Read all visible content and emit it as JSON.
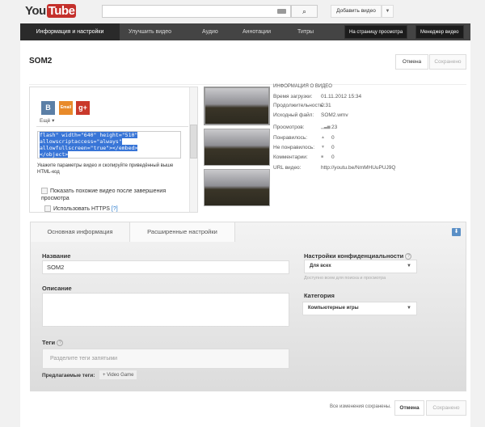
{
  "header": {
    "logo": "You",
    "logo_tube": "Tube",
    "search_placeholder": "",
    "upload_label": "Добавить видео"
  },
  "nav": {
    "tabs": [
      "Информация и настройки",
      "Улучшить видео",
      "Аудио",
      "Аннотации",
      "Титры"
    ],
    "view_page": "На страницу просмотра",
    "video_manager": "Менеджер видео"
  },
  "page": {
    "title": "SOM2",
    "cancel": "Отмена",
    "saved": "Сохранено"
  },
  "share": {
    "social": [
      "B",
      "Email",
      "g+"
    ],
    "more": "Ещё ▾",
    "code_lines": [
      "flash\" width=\"640\" height=\"510\"",
      "allowscriptaccess=\"always\"",
      "allowfullscreen=\"true\"></embed>",
      "</object>"
    ],
    "hint": "Укажите параметры видео и скопируйте приведённый выше HTML-код",
    "opt1": "Показать похожие видео после завершения просмотра",
    "opt2": "Использовать HTTPS",
    "opt2_link": "[?]"
  },
  "video_info": {
    "heading": "ИНФОРМАЦИЯ О ВИДЕО",
    "rows": [
      [
        "Время загрузки:",
        "01.11.2012 15:34"
      ],
      [
        "Продолжительность:",
        "0:31"
      ],
      [
        "Исходный файл:",
        "SOM2.wmv"
      ],
      [
        "Просмотров:",
        "23"
      ],
      [
        "Понравилось:",
        "0"
      ],
      [
        "Не понравилось:",
        "0"
      ],
      [
        "Комментарии:",
        "0"
      ],
      [
        "URL видео:",
        "http://youtu.be/NmMHUuPUJ9Q"
      ]
    ]
  },
  "form": {
    "tabs": [
      "Основная информация",
      "Расширенные настройки"
    ],
    "title_label": "Название",
    "title_value": "SOM2",
    "desc_label": "Описание",
    "desc_value": "",
    "tags_label": "Теги",
    "tags_placeholder": "Разделите теги запятыми",
    "suggested_label": "Предлагаемые теги:",
    "suggested_tag": "+ Video Game",
    "privacy_label": "Настройки конфиденциальности",
    "privacy_value": "Для всех",
    "privacy_hint": "Доступно всем для поиска и просмотра",
    "category_label": "Категория",
    "category_value": "Компьютерные игры"
  },
  "footer": {
    "status": "Все изменения сохранены.",
    "cancel": "Отмена",
    "saved": "Сохранено"
  }
}
